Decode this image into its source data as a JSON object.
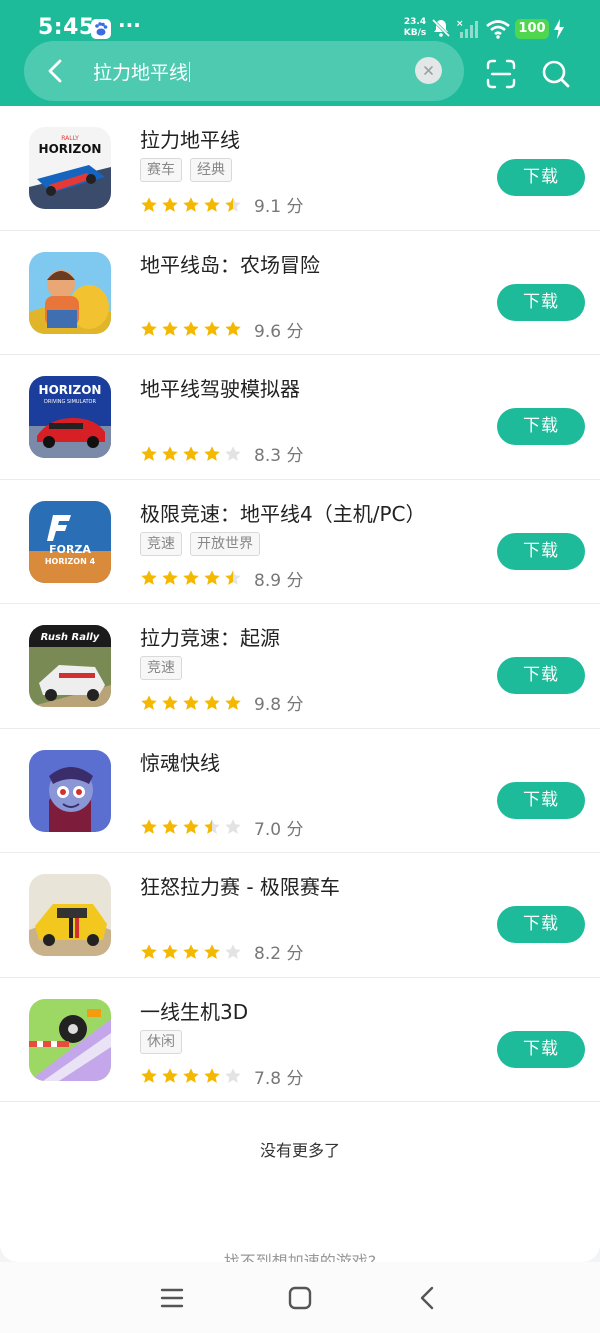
{
  "status_bar": {
    "time": "5:45",
    "dots": "···",
    "net_speed_value": "23.4",
    "net_speed_unit": "KB/s",
    "battery": "100"
  },
  "search": {
    "query": "拉力地平线"
  },
  "apps": [
    {
      "name": "拉力地平线",
      "tags": [
        "赛车",
        "经典"
      ],
      "rating": 4.5,
      "score": "9.1 分",
      "button": "下载",
      "icon": "horizon-rally-icon"
    },
    {
      "name": "地平线岛：农场冒险",
      "tags": [],
      "rating": 5,
      "score": "9.6 分",
      "button": "下载",
      "icon": "farm-adventure-icon"
    },
    {
      "name": "地平线驾驶模拟器",
      "tags": [],
      "rating": 4,
      "score": "8.3 分",
      "button": "下载",
      "icon": "horizon-driving-icon"
    },
    {
      "name": "极限竞速：地平线4（主机/PC）",
      "tags": [
        "竞速",
        "开放世界"
      ],
      "rating": 4.5,
      "score": "8.9 分",
      "button": "下载",
      "icon": "forza-horizon-icon"
    },
    {
      "name": "拉力竞速：起源",
      "tags": [
        "竞速"
      ],
      "rating": 5,
      "score": "9.8 分",
      "button": "下载",
      "icon": "rush-rally-icon"
    },
    {
      "name": "惊魂快线",
      "tags": [],
      "rating": 3.5,
      "score": "7.0 分",
      "button": "下载",
      "icon": "vampire-icon"
    },
    {
      "name": "狂怒拉力赛 - 极限赛车",
      "tags": [],
      "rating": 4,
      "score": "8.2 分",
      "button": "下载",
      "icon": "rally-car-icon"
    },
    {
      "name": "一线生机3D",
      "tags": [
        "休闲"
      ],
      "rating": 4,
      "score": "7.8 分",
      "button": "下载",
      "icon": "tire-road-icon"
    }
  ],
  "footer": {
    "no_more": "没有更多了",
    "hint": "找不到想加速的游戏?"
  },
  "colors": {
    "accent": "#1dbb9a",
    "star": "#f5b800",
    "star_empty": "#e3e3e3"
  }
}
